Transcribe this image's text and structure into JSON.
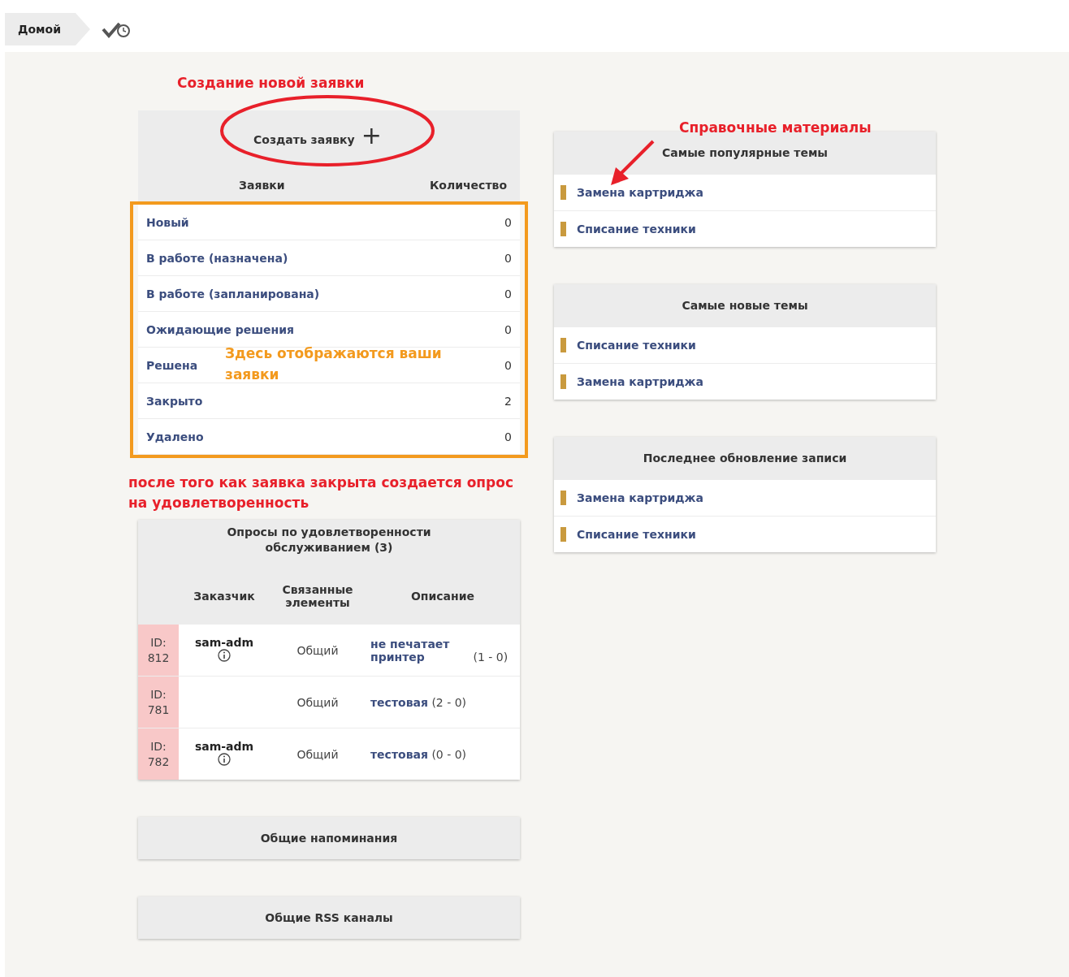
{
  "breadcrumb": {
    "label": "Домой"
  },
  "tickets": {
    "note": "Создание новой заявки",
    "create_button": "Создать заявку",
    "create_icon": "+",
    "columns": [
      "Заявки",
      "Количество"
    ],
    "rows": [
      {
        "label": "Новый",
        "count": "0"
      },
      {
        "label": "В работе (назначена)",
        "count": "0"
      },
      {
        "label": "В работе (запланирована)",
        "count": "0"
      },
      {
        "label": "Ожидающие решения",
        "count": "0"
      },
      {
        "label": "Решена",
        "count": "0"
      },
      {
        "label": "Закрыто",
        "count": "2"
      },
      {
        "label": "Удалено",
        "count": "0"
      }
    ],
    "frame_note": "Здесь отображаются ваши заявки"
  },
  "surveys": {
    "note": "после того как заявка закрыта создается опрос на удовлетворенность",
    "title": "Опросы по удовлетворенности обслуживанием (3)",
    "columns": [
      "Заказчик",
      "Связанные элементы",
      "Описание"
    ],
    "rows": [
      {
        "id": "ID: 812",
        "customer": "sam-adm",
        "info": true,
        "element": "Общий",
        "link": "не печатает принтер",
        "score": "(1 - 0)"
      },
      {
        "id": "ID: 781",
        "info": false,
        "element": "Общий",
        "link": "тестовая",
        "score": "(2 - 0)"
      },
      {
        "id": "ID: 782",
        "customer": "sam-adm",
        "info": true,
        "element": "Общий",
        "link": "тестовая",
        "score": "(0 - 0)"
      }
    ]
  },
  "reminders": {
    "title": "Общие напоминания"
  },
  "rss": {
    "title": "Общие RSS каналы"
  },
  "topics_note": "Справочные материалы",
  "topic_cards": [
    {
      "title": "Самые популярные темы",
      "items": [
        "Замена картриджа",
        "Списание техники"
      ]
    },
    {
      "title": "Самые новые темы",
      "items": [
        "Списание техники",
        "Замена картриджа"
      ]
    },
    {
      "title": "Последнее обновление записи",
      "items": [
        "Замена картриджа",
        "Списание техники"
      ]
    }
  ]
}
